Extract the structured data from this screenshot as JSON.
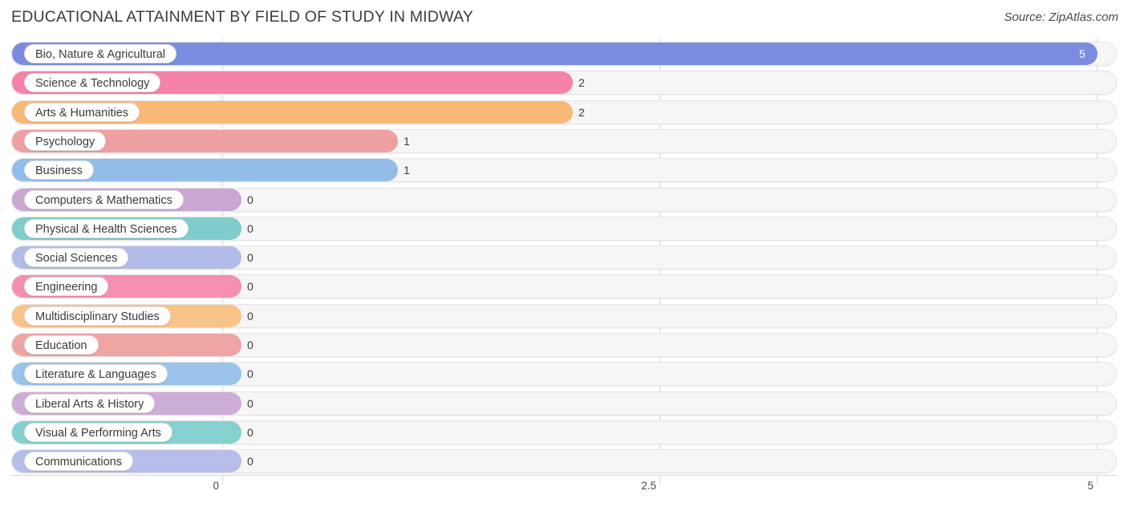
{
  "header": {
    "title": "EDUCATIONAL ATTAINMENT BY FIELD OF STUDY IN MIDWAY",
    "source": "Source: ZipAtlas.com"
  },
  "chart_data": {
    "type": "bar",
    "orientation": "horizontal",
    "title": "EDUCATIONAL ATTAINMENT BY FIELD OF STUDY IN MIDWAY",
    "xlabel": "",
    "ylabel": "",
    "xlim": [
      0,
      5
    ],
    "xticks": [
      0,
      2.5,
      5
    ],
    "xtick_labels": [
      "0",
      "2.5",
      "5"
    ],
    "grid": true,
    "legend": false,
    "categories": [
      "Bio, Nature & Agricultural",
      "Science & Technology",
      "Arts & Humanities",
      "Psychology",
      "Business",
      "Computers & Mathematics",
      "Physical & Health Sciences",
      "Social Sciences",
      "Engineering",
      "Multidisciplinary Studies",
      "Education",
      "Literature & Languages",
      "Liberal Arts & History",
      "Visual & Performing Arts",
      "Communications"
    ],
    "values": [
      5,
      2,
      2,
      1,
      1,
      0,
      0,
      0,
      0,
      0,
      0,
      0,
      0,
      0,
      0
    ],
    "value_labels": [
      "5",
      "2",
      "2",
      "1",
      "1",
      "0",
      "0",
      "0",
      "0",
      "0",
      "0",
      "0",
      "0",
      "0",
      "0"
    ],
    "colors": [
      "#7b8ce0",
      "#f582a8",
      "#f9b976",
      "#efa0a0",
      "#93bde8",
      "#c9a8d4",
      "#7fcdcd",
      "#b3bbe8",
      "#f58fb0",
      "#f9c38a",
      "#efa4a4",
      "#9cc3ea",
      "#ceadd6",
      "#86d0cf",
      "#b6bee9"
    ],
    "track_color": "#f6f6f6",
    "grid_color": "#d7d7d7"
  }
}
